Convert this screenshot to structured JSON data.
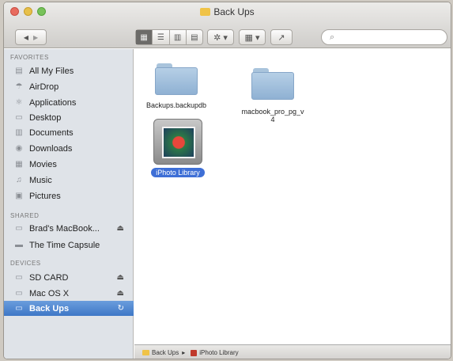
{
  "window": {
    "title": "Back Ups"
  },
  "toolbar": {
    "back_glyph": "◀",
    "forward_glyph": "▶",
    "view_icons": [
      "▦",
      "☰",
      "▥",
      "▤"
    ],
    "gear_label": "✲ ▾",
    "arrange_label": "▦ ▾",
    "share_label": "↗",
    "search_icon": "⌕",
    "search_placeholder": ""
  },
  "sidebar": {
    "favorites_header": "FAVORITES",
    "favorites": [
      {
        "label": "All My Files",
        "icon": "all-files-icon",
        "glyph": "▤"
      },
      {
        "label": "AirDrop",
        "icon": "airdrop-icon",
        "glyph": "☂"
      },
      {
        "label": "Applications",
        "icon": "applications-icon",
        "glyph": "⚛"
      },
      {
        "label": "Desktop",
        "icon": "desktop-icon",
        "glyph": "▭"
      },
      {
        "label": "Documents",
        "icon": "documents-icon",
        "glyph": "▥"
      },
      {
        "label": "Downloads",
        "icon": "downloads-icon",
        "glyph": "◉"
      },
      {
        "label": "Movies",
        "icon": "movies-icon",
        "glyph": "▦"
      },
      {
        "label": "Music",
        "icon": "music-icon",
        "glyph": "♫"
      },
      {
        "label": "Pictures",
        "icon": "pictures-icon",
        "glyph": "▣"
      }
    ],
    "shared_header": "SHARED",
    "shared": [
      {
        "label": "Brad's MacBook...",
        "icon": "laptop-icon",
        "glyph": "▭",
        "eject": "⏏"
      },
      {
        "label": "The Time Capsule",
        "icon": "time-capsule-icon",
        "glyph": "▬"
      }
    ],
    "devices_header": "DEVICES",
    "devices": [
      {
        "label": "SD CARD",
        "icon": "sd-card-icon",
        "glyph": "▭",
        "eject": "⏏"
      },
      {
        "label": "Mac OS X",
        "icon": "hard-drive-icon",
        "glyph": "▭",
        "eject": "⏏"
      },
      {
        "label": "Back Ups",
        "icon": "backup-drive-icon",
        "glyph": "▭",
        "eject": "↻",
        "selected": true
      }
    ]
  },
  "content": {
    "items": [
      {
        "label": "Backups.backupdb",
        "type": "folder"
      },
      {
        "label": "macbook_pro_pg_v4",
        "type": "folder"
      },
      {
        "label": "iPhoto Library",
        "type": "photo-library",
        "selected": true
      }
    ]
  },
  "statusbar": {
    "path_root": "Back Ups",
    "separator": "▸",
    "path_leaf": "iPhoto Library"
  }
}
